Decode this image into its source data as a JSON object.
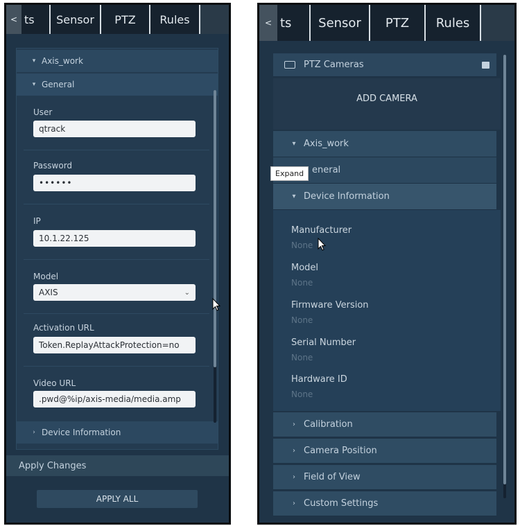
{
  "left": {
    "tabs": {
      "back": "<",
      "partial": "ts",
      "sensor": "Sensor",
      "ptz": "PTZ",
      "rules": "Rules"
    },
    "camera_section": "Axis_work",
    "general_section": "General",
    "user": {
      "label": "User",
      "value": "qtrack"
    },
    "password": {
      "label": "Password",
      "value": "••••••"
    },
    "ip": {
      "label": "IP",
      "value": "10.1.22.125"
    },
    "model": {
      "label": "Model",
      "value": "AXIS"
    },
    "activation_url": {
      "label": "Activation URL",
      "value": "Token.ReplayAttackProtection=no"
    },
    "video_url": {
      "label": "Video URL",
      "value": ".pwd@%ip/axis-media/media.amp"
    },
    "device_info_section": "Device Information",
    "apply_changes": "Apply Changes",
    "apply_all": "APPLY ALL"
  },
  "right": {
    "tabs": {
      "back": "<",
      "partial": "ts",
      "sensor": "Sensor",
      "ptz": "PTZ",
      "rules": "Rules"
    },
    "ptz_cameras": "PTZ Cameras",
    "add_camera": "ADD CAMERA",
    "camera_section": "Axis_work",
    "general_section": "eneral",
    "tooltip": "Expand",
    "device_info_section": "Device Information",
    "fields": [
      {
        "label": "Manufacturer",
        "value": "None"
      },
      {
        "label": "Model",
        "value": "None"
      },
      {
        "label": "Firmware Version",
        "value": "None"
      },
      {
        "label": "Serial Number",
        "value": "None"
      },
      {
        "label": "Hardware ID",
        "value": "None"
      }
    ],
    "collapsed_sections": [
      "Calibration",
      "Camera Position",
      "Field of View",
      "Custom Settings"
    ]
  }
}
